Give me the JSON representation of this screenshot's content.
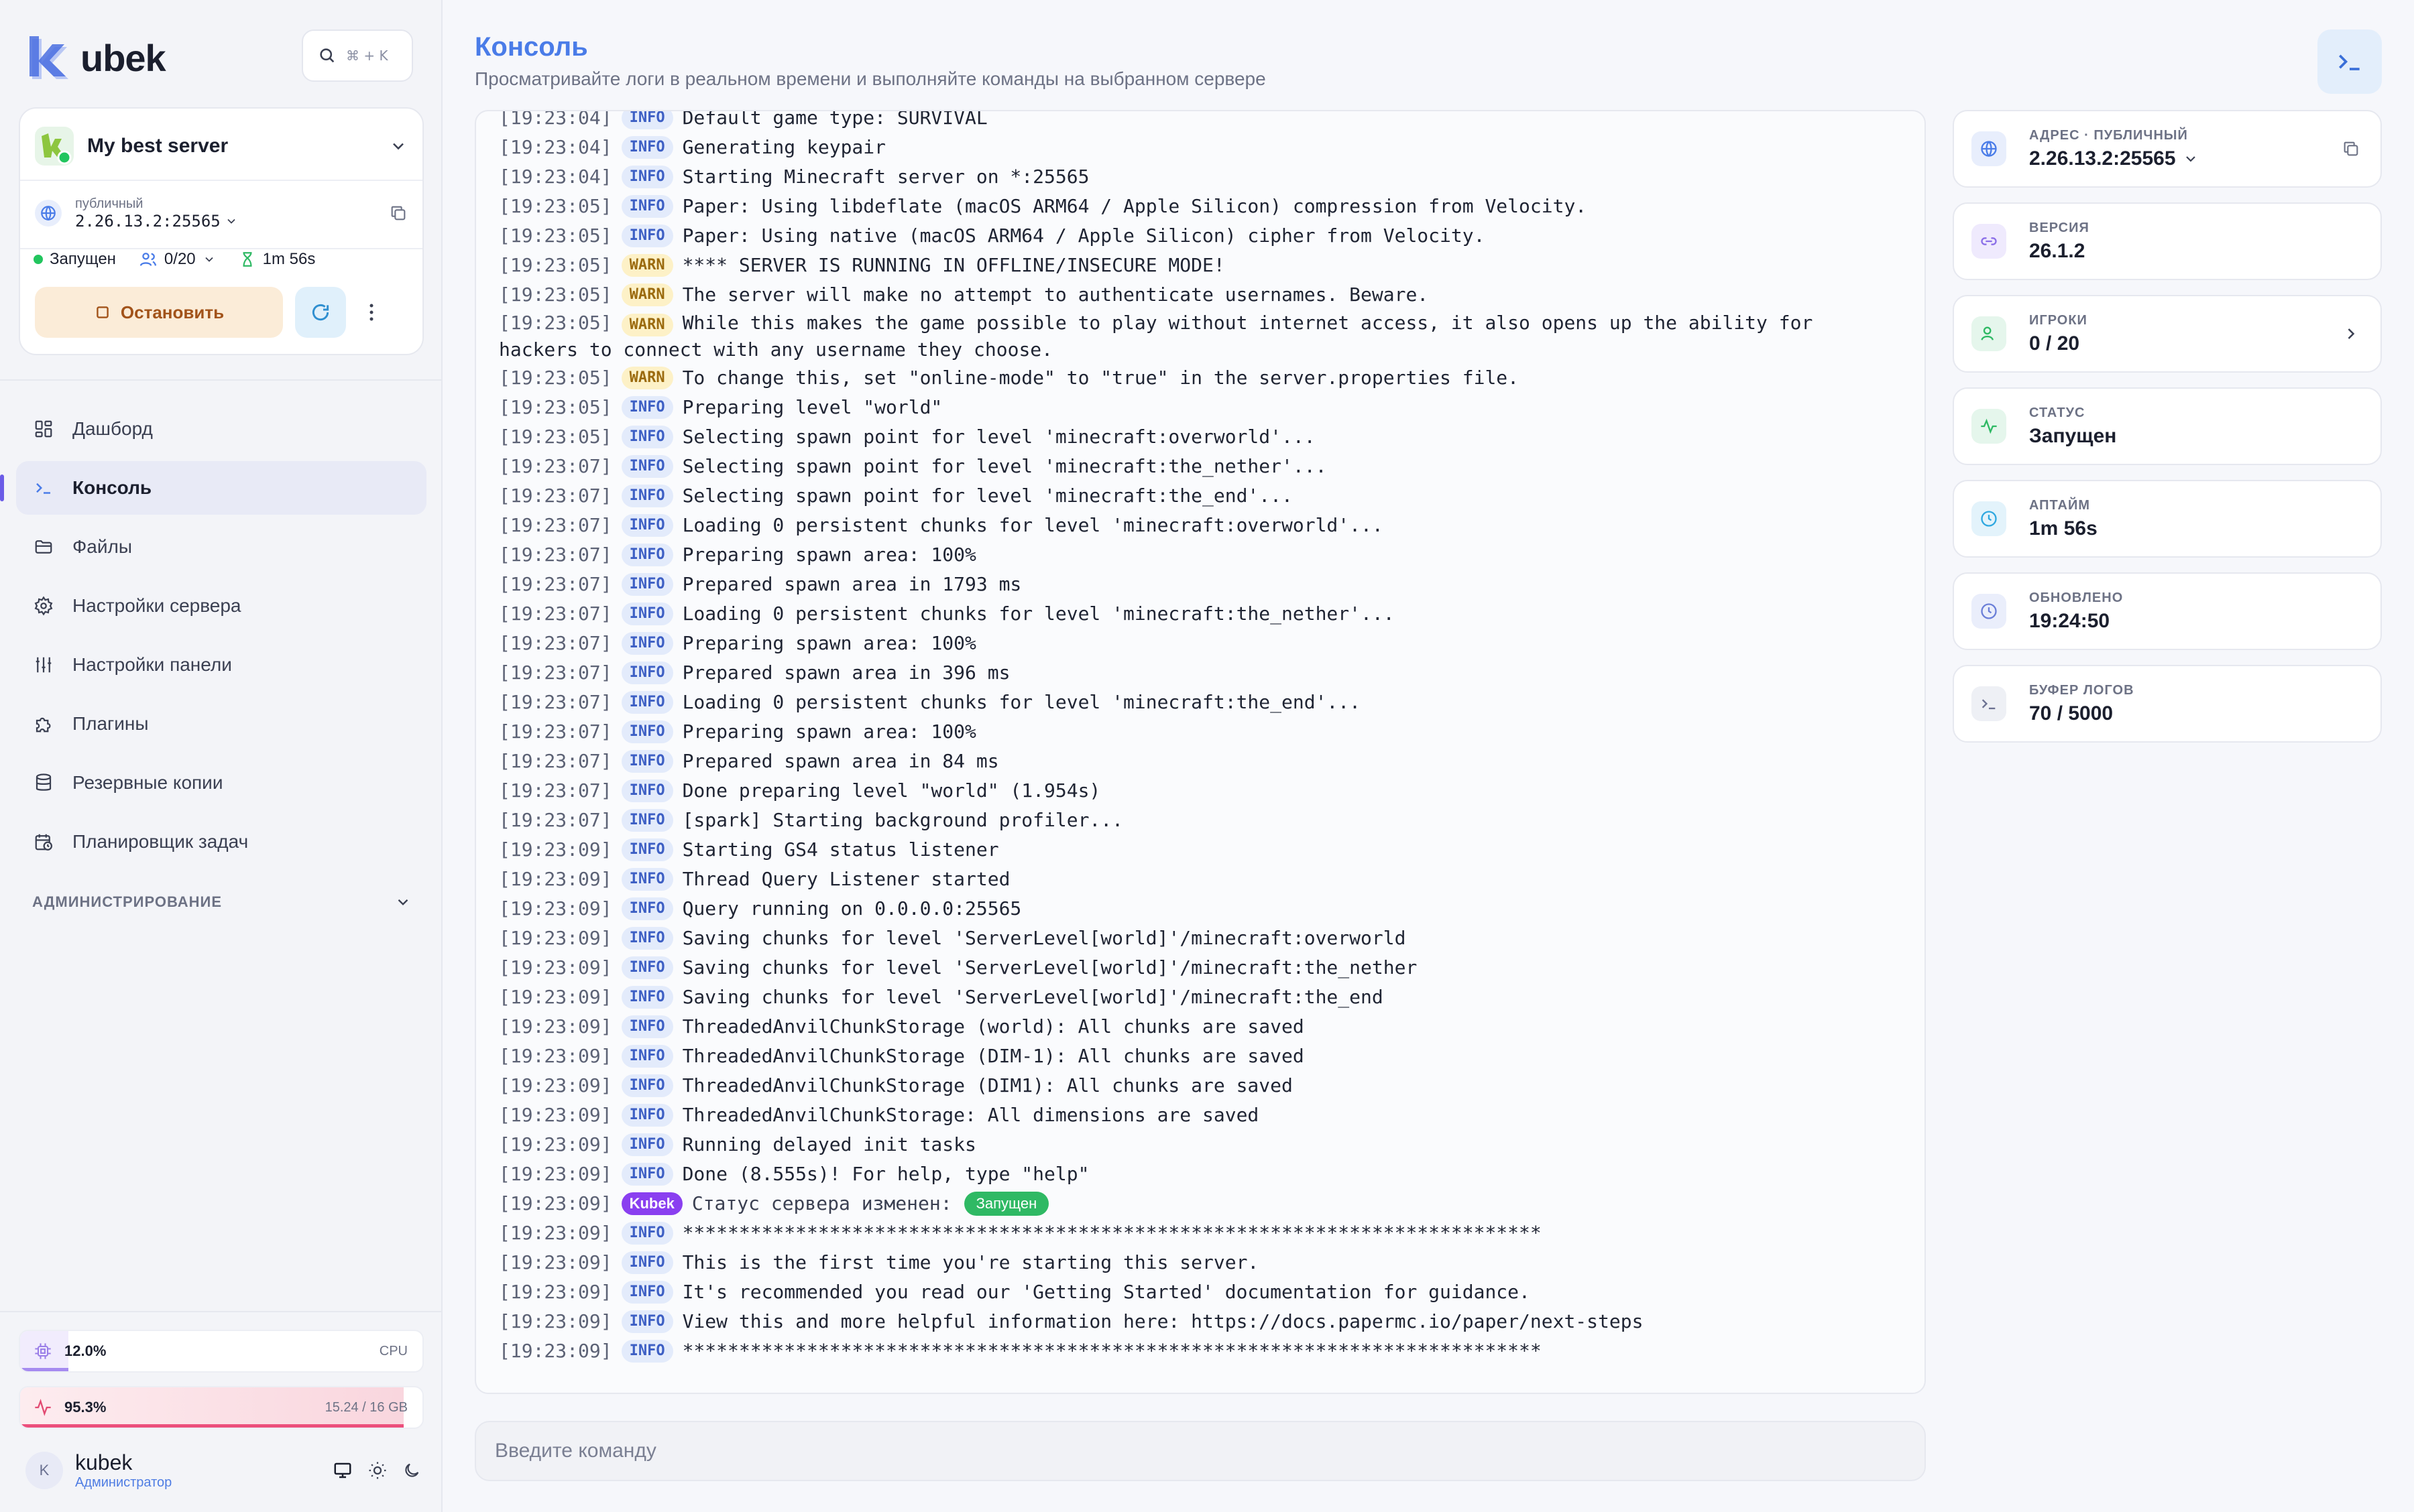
{
  "app": {
    "logo_text": "ubek"
  },
  "search": {
    "shortcut": "⌘ + K"
  },
  "server": {
    "name": "My best server",
    "address_label": "публичный",
    "address": "2.26.13.2:25565",
    "status": "Запущен",
    "players": "0/20",
    "uptime": "1m 56s",
    "stop_label": "Остановить",
    "status_color": "#22c55e"
  },
  "nav": {
    "items": [
      {
        "label": "Дашборд",
        "icon": "dashboard-icon"
      },
      {
        "label": "Консоль",
        "icon": "terminal-icon",
        "active": true
      },
      {
        "label": "Файлы",
        "icon": "folder-icon"
      },
      {
        "label": "Настройки сервера",
        "icon": "gear-icon"
      },
      {
        "label": "Настройки панели",
        "icon": "sliders-icon"
      },
      {
        "label": "Плагины",
        "icon": "puzzle-icon"
      },
      {
        "label": "Резервные копии",
        "icon": "database-icon"
      },
      {
        "label": "Планировщик задач",
        "icon": "calendar-clock-icon"
      }
    ],
    "admin_section": "АДМИНИСТРИРОВАНИЕ"
  },
  "resources": {
    "cpu": {
      "value": "12.0%",
      "label": "CPU",
      "fraction": 0.12
    },
    "ram": {
      "value": "95.3%",
      "label": "15.24 / 16 GB",
      "fraction": 0.953
    }
  },
  "user": {
    "name": "kubek",
    "role": "Администратор",
    "initial": "K"
  },
  "page": {
    "title": "Консоль",
    "subtitle": "Просматривайте логи в реальном времени и выполняйте команды на выбранном сервере"
  },
  "console": {
    "input_placeholder": "Введите команду",
    "lines": [
      {
        "ts": "[19:23:04]",
        "lvl": "INFO",
        "msg": "Default game type: SURVIVAL"
      },
      {
        "ts": "[19:23:04]",
        "lvl": "INFO",
        "msg": "Generating keypair"
      },
      {
        "ts": "[19:23:04]",
        "lvl": "INFO",
        "msg": "Starting Minecraft server on *:25565"
      },
      {
        "ts": "[19:23:05]",
        "lvl": "INFO",
        "msg": "Paper: Using libdeflate (macOS ARM64 / Apple Silicon) compression from Velocity."
      },
      {
        "ts": "[19:23:05]",
        "lvl": "INFO",
        "msg": "Paper: Using native (macOS ARM64 / Apple Silicon) cipher from Velocity."
      },
      {
        "ts": "[19:23:05]",
        "lvl": "WARN",
        "msg": "**** SERVER IS RUNNING IN OFFLINE/INSECURE MODE!"
      },
      {
        "ts": "[19:23:05]",
        "lvl": "WARN",
        "msg": "The server will make no attempt to authenticate usernames. Beware."
      },
      {
        "ts": "[19:23:05]",
        "lvl": "WARN",
        "msg": "While this makes the game possible to play without internet access, it also opens up the ability for hackers to connect with any username they choose.",
        "wrap": true
      },
      {
        "ts": "[19:23:05]",
        "lvl": "WARN",
        "msg": "To change this, set \"online-mode\" to \"true\" in the server.properties file."
      },
      {
        "ts": "[19:23:05]",
        "lvl": "INFO",
        "msg": "Preparing level \"world\""
      },
      {
        "ts": "[19:23:05]",
        "lvl": "INFO",
        "msg": "Selecting spawn point for level 'minecraft:overworld'..."
      },
      {
        "ts": "[19:23:07]",
        "lvl": "INFO",
        "msg": "Selecting spawn point for level 'minecraft:the_nether'..."
      },
      {
        "ts": "[19:23:07]",
        "lvl": "INFO",
        "msg": "Selecting spawn point for level 'minecraft:the_end'..."
      },
      {
        "ts": "[19:23:07]",
        "lvl": "INFO",
        "msg": "Loading 0 persistent chunks for level 'minecraft:overworld'..."
      },
      {
        "ts": "[19:23:07]",
        "lvl": "INFO",
        "msg": "Preparing spawn area: 100%"
      },
      {
        "ts": "[19:23:07]",
        "lvl": "INFO",
        "msg": "Prepared spawn area in 1793 ms"
      },
      {
        "ts": "[19:23:07]",
        "lvl": "INFO",
        "msg": "Loading 0 persistent chunks for level 'minecraft:the_nether'..."
      },
      {
        "ts": "[19:23:07]",
        "lvl": "INFO",
        "msg": "Preparing spawn area: 100%"
      },
      {
        "ts": "[19:23:07]",
        "lvl": "INFO",
        "msg": "Prepared spawn area in 396 ms"
      },
      {
        "ts": "[19:23:07]",
        "lvl": "INFO",
        "msg": "Loading 0 persistent chunks for level 'minecraft:the_end'..."
      },
      {
        "ts": "[19:23:07]",
        "lvl": "INFO",
        "msg": "Preparing spawn area: 100%"
      },
      {
        "ts": "[19:23:07]",
        "lvl": "INFO",
        "msg": "Prepared spawn area in 84 ms"
      },
      {
        "ts": "[19:23:07]",
        "lvl": "INFO",
        "msg": "Done preparing level \"world\" (1.954s)"
      },
      {
        "ts": "[19:23:07]",
        "lvl": "INFO",
        "msg": "[spark] Starting background profiler..."
      },
      {
        "ts": "[19:23:09]",
        "lvl": "INFO",
        "msg": "Starting GS4 status listener"
      },
      {
        "ts": "[19:23:09]",
        "lvl": "INFO",
        "msg": "Thread Query Listener started"
      },
      {
        "ts": "[19:23:09]",
        "lvl": "INFO",
        "msg": "Query running on 0.0.0.0:25565"
      },
      {
        "ts": "[19:23:09]",
        "lvl": "INFO",
        "msg": "Saving chunks for level 'ServerLevel[world]'/minecraft:overworld"
      },
      {
        "ts": "[19:23:09]",
        "lvl": "INFO",
        "msg": "Saving chunks for level 'ServerLevel[world]'/minecraft:the_nether"
      },
      {
        "ts": "[19:23:09]",
        "lvl": "INFO",
        "msg": "Saving chunks for level 'ServerLevel[world]'/minecraft:the_end"
      },
      {
        "ts": "[19:23:09]",
        "lvl": "INFO",
        "msg": "ThreadedAnvilChunkStorage (world): All chunks are saved"
      },
      {
        "ts": "[19:23:09]",
        "lvl": "INFO",
        "msg": "ThreadedAnvilChunkStorage (DIM-1): All chunks are saved"
      },
      {
        "ts": "[19:23:09]",
        "lvl": "INFO",
        "msg": "ThreadedAnvilChunkStorage (DIM1): All chunks are saved"
      },
      {
        "ts": "[19:23:09]",
        "lvl": "INFO",
        "msg": "ThreadedAnvilChunkStorage: All dimensions are saved"
      },
      {
        "ts": "[19:23:09]",
        "lvl": "INFO",
        "msg": "Running delayed init tasks"
      },
      {
        "ts": "[19:23:09]",
        "lvl": "INFO",
        "msg": "Done (8.555s)! For help, type \"help\""
      },
      {
        "ts": "[19:23:09]",
        "lvl": "Kubek",
        "msg": "Статус сервера изменен:",
        "pill": "Запущен"
      },
      {
        "ts": "[19:23:09]",
        "lvl": "INFO",
        "msg": "****************************************************************************"
      },
      {
        "ts": "[19:23:09]",
        "lvl": "INFO",
        "msg": "This is the first time you're starting this server."
      },
      {
        "ts": "[19:23:09]",
        "lvl": "INFO",
        "msg": "It's recommended you read our 'Getting Started' documentation for guidance."
      },
      {
        "ts": "[19:23:09]",
        "lvl": "INFO",
        "msg": "View this and more helpful information here: https://docs.papermc.io/paper/next-steps"
      },
      {
        "ts": "[19:23:09]",
        "lvl": "INFO",
        "msg": "****************************************************************************"
      }
    ]
  },
  "info": {
    "cards": [
      {
        "label": "АДРЕС · ПУБЛИЧНЫЙ",
        "value": "2.26.13.2:25565",
        "icon": "globe-icon",
        "color": "#4a7ce8",
        "bg": "#e8eefc",
        "right": "copy",
        "dropdown": true
      },
      {
        "label": "ВЕРСИЯ",
        "value": "26.1.2",
        "icon": "link-icon",
        "color": "#8b6fe8",
        "bg": "#efeafd"
      },
      {
        "label": "ИГРОКИ",
        "value": "0 / 20",
        "icon": "user-icon",
        "color": "#2fb964",
        "bg": "#e5f6ec",
        "right": "chevron"
      },
      {
        "label": "СТАТУС",
        "value": "Запущен",
        "icon": "activity-icon",
        "color": "#2fb964",
        "bg": "#e5f6ec"
      },
      {
        "label": "АПТАЙМ",
        "value": "1m 56s",
        "icon": "clock-icon",
        "color": "#2fa8e0",
        "bg": "#e3f3fb"
      },
      {
        "label": "ОБНОВЛЕНО",
        "value": "19:24:50",
        "icon": "clock-icon",
        "color": "#6b7fd8",
        "bg": "#eaeefb"
      },
      {
        "label": "БУФЕР ЛОГОВ",
        "value": "70 / 5000",
        "icon": "terminal-icon",
        "color": "#6b7191",
        "bg": "#eef0f5"
      }
    ]
  }
}
